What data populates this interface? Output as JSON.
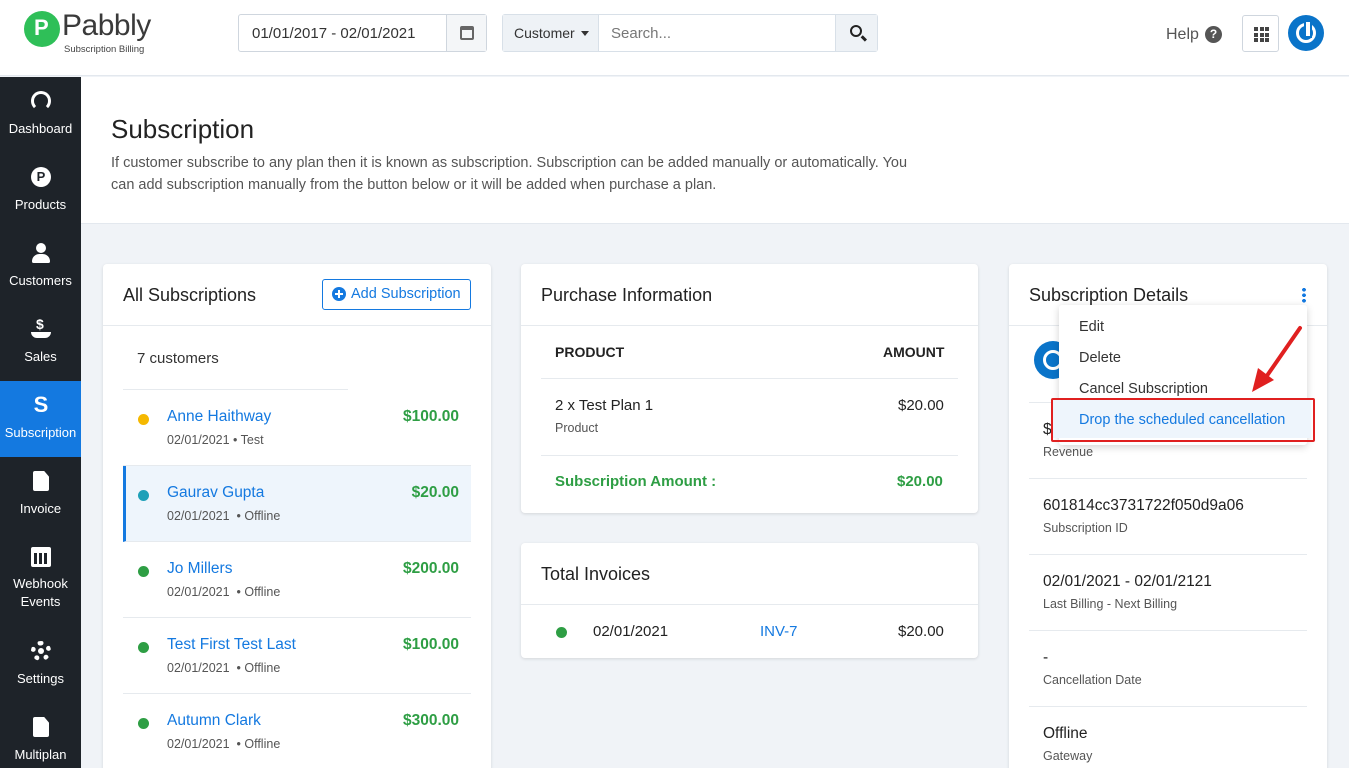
{
  "brand": {
    "name": "Pabbly",
    "tagline": "Subscription Billing"
  },
  "topbar": {
    "date_range": "01/01/2017 - 02/01/2021",
    "search_filter": "Customer",
    "search_placeholder": "Search...",
    "help_label": "Help"
  },
  "sidebar": {
    "items": [
      {
        "label": "Dashboard",
        "icon": "dashboard-icon"
      },
      {
        "label": "Products",
        "icon": "products-icon"
      },
      {
        "label": "Customers",
        "icon": "customers-icon"
      },
      {
        "label": "Sales",
        "icon": "sales-icon"
      },
      {
        "label": "Subscription",
        "icon": "subscription-icon",
        "active": true
      },
      {
        "label": "Invoice",
        "icon": "invoice-icon"
      },
      {
        "label": "Webhook Events",
        "icon": "calendar-icon"
      },
      {
        "label": "Settings",
        "icon": "gear-icon"
      },
      {
        "label": "Multiplan",
        "icon": "document-icon"
      }
    ]
  },
  "page": {
    "title": "Subscription",
    "description": "If customer subscribe to any plan then it is known as subscription. Subscription can be added manually or automatically. You can add subscription manually from the button below or it will be added when purchase a plan."
  },
  "all_subscriptions": {
    "title": "All Subscriptions",
    "add_button": "Add Subscription",
    "count_text": "7 customers",
    "rows": [
      {
        "name": "Anne Haithway",
        "date": "02/01/2021",
        "gateway": "• Test",
        "amount": "$100.00",
        "status_color": "#f5b800"
      },
      {
        "name": "Gaurav Gupta",
        "date": "02/01/2021",
        "gateway": "• Offline",
        "amount": "$20.00",
        "status_color": "#1ea0b8",
        "selected": true
      },
      {
        "name": "Jo Millers",
        "date": "02/01/2021",
        "gateway": "• Offline",
        "amount": "$200.00",
        "status_color": "#2e9e44"
      },
      {
        "name": "Test First Test Last",
        "date": "02/01/2021",
        "gateway": "• Offline",
        "amount": "$100.00",
        "status_color": "#2e9e44"
      },
      {
        "name": "Autumn Clark",
        "date": "02/01/2021",
        "gateway": "• Offline",
        "amount": "$300.00",
        "status_color": "#2e9e44"
      }
    ]
  },
  "purchase_info": {
    "title": "Purchase Information",
    "col_product": "PRODUCT",
    "col_amount": "AMOUNT",
    "item_name": "2 x Test Plan 1",
    "item_type": "Product",
    "item_amount": "$20.00",
    "total_label": "Subscription Amount :",
    "total_amount": "$20.00"
  },
  "total_invoices": {
    "title": "Total Invoices",
    "rows": [
      {
        "date": "02/01/2021",
        "invoice": "INV-7",
        "amount": "$20.00",
        "status_color": "#2e9e44"
      }
    ]
  },
  "subscription_details": {
    "title": "Subscription Details",
    "revenue_value": "$2",
    "revenue_label": "Revenue",
    "subscription_id": "601814cc3731722f050d9a06",
    "subscription_id_label": "Subscription ID",
    "billing_value": "02/01/2021 - 02/01/2121",
    "billing_label": "Last Billing - Next Billing",
    "cancellation_value": "-",
    "cancellation_label": "Cancellation Date",
    "gateway_value": "Offline",
    "gateway_label": "Gateway"
  },
  "action_menu": {
    "items": [
      "Edit",
      "Delete",
      "Cancel Subscription",
      "Drop the scheduled cancellation"
    ],
    "highlighted_item": "Drop the scheduled cancellation"
  },
  "colors": {
    "accent": "#1479e0",
    "sidebar": "#1e2329",
    "success": "#2e9e44",
    "annotation": "#e02020"
  }
}
